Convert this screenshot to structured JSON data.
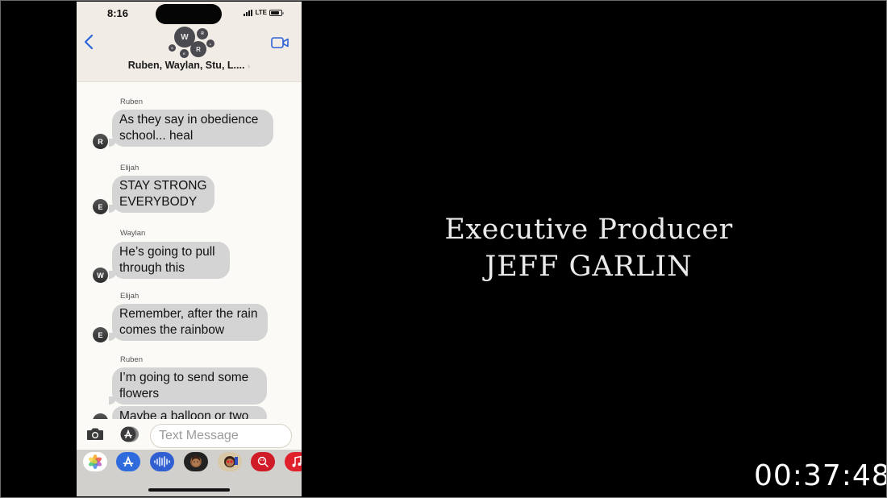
{
  "status_bar": {
    "time": "8:16",
    "network": "LTE",
    "battery_level": 0.85
  },
  "conversation": {
    "title": "Ruben, Waylan, Stu, L....",
    "back_icon": "chevron-left-icon",
    "video_icon": "video-camera-icon",
    "group_avatars": [
      "W",
      "R",
      "L",
      "R",
      "E",
      "S"
    ]
  },
  "messages": [
    {
      "sender": "Ruben",
      "initial": "R",
      "text": "As they say in obedience school... heal"
    },
    {
      "sender": "Elijah",
      "initial": "E",
      "text": "STAY STRONG EVERYBODY"
    },
    {
      "sender": "Waylan",
      "initial": "W",
      "text": "He’s going to pull through this"
    },
    {
      "sender": "Elijah",
      "initial": "E",
      "text": "Remember, after the rain comes the rainbow"
    },
    {
      "sender": "Ruben",
      "initial": "R",
      "text": "I’m going to send some flowers"
    },
    {
      "sender": "",
      "initial": "",
      "text": "Maybe a balloon or two"
    }
  ],
  "composer": {
    "placeholder": "Text Message",
    "camera_icon": "camera-icon",
    "apps_icon": "app-store-icon"
  },
  "app_strip": [
    {
      "name": "photos-icon",
      "color": "#ffffff"
    },
    {
      "name": "app-store-icon",
      "color": "#2f6bdc"
    },
    {
      "name": "audio-message-icon",
      "color": "#2f5fd0"
    },
    {
      "name": "memoji-icon",
      "color": "#222222"
    },
    {
      "name": "memoji-stickers-icon",
      "color": "#d8c8a8"
    },
    {
      "name": "image-search-icon",
      "color": "#d01c28"
    },
    {
      "name": "music-icon",
      "color": "#e0202a"
    }
  ],
  "credits": {
    "role": "Executive Producer",
    "name": "JEFF GARLIN"
  },
  "timecode": "00:37:48"
}
